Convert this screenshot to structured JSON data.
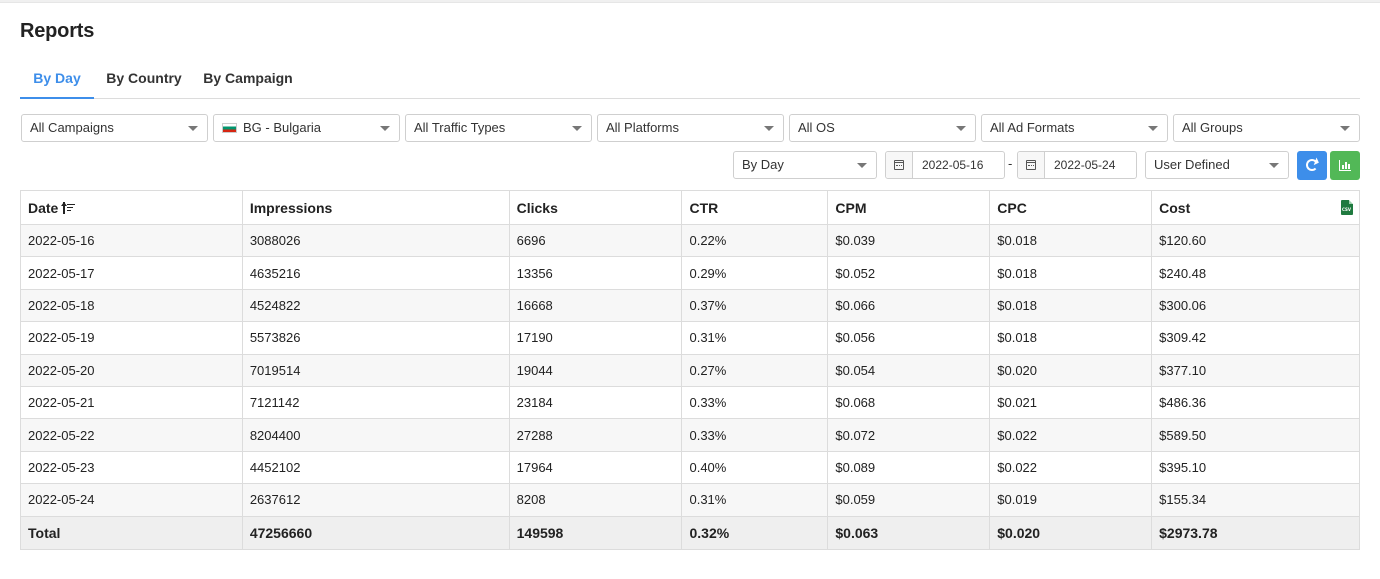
{
  "page": {
    "title": "Reports"
  },
  "tabs": [
    {
      "label": "By Day",
      "active": true
    },
    {
      "label": "By Country",
      "active": false
    },
    {
      "label": "By Campaign",
      "active": false
    }
  ],
  "filters": {
    "campaigns": "All Campaigns",
    "country": "BG - Bulgaria",
    "traffic_types": "All Traffic Types",
    "platforms": "All Platforms",
    "os": "All OS",
    "ad_formats": "All Ad Formats",
    "groups": "All Groups",
    "group_by": "By Day",
    "date_from": "2022-05-16",
    "date_separator": "-",
    "date_to": "2022-05-24",
    "range_preset": "User Defined"
  },
  "icons": {
    "country_flag": "bulgaria-flag-icon",
    "calendar": "calendar-icon",
    "refresh": "refresh-icon",
    "chart": "bar-chart-icon",
    "sort": "sort-ascending-icon",
    "export": "csv-export-icon"
  },
  "colors": {
    "accent": "#3d8eea",
    "success": "#52b857",
    "csv": "#1f7a3f"
  },
  "table": {
    "columns": [
      "Date",
      "Impressions",
      "Clicks",
      "CTR",
      "CPM",
      "CPC",
      "Cost"
    ],
    "csv_label": "CSV",
    "rows": [
      [
        "2022-05-16",
        "3088026",
        "6696",
        "0.22%",
        "$0.039",
        "$0.018",
        "$120.60"
      ],
      [
        "2022-05-17",
        "4635216",
        "13356",
        "0.29%",
        "$0.052",
        "$0.018",
        "$240.48"
      ],
      [
        "2022-05-18",
        "4524822",
        "16668",
        "0.37%",
        "$0.066",
        "$0.018",
        "$300.06"
      ],
      [
        "2022-05-19",
        "5573826",
        "17190",
        "0.31%",
        "$0.056",
        "$0.018",
        "$309.42"
      ],
      [
        "2022-05-20",
        "7019514",
        "19044",
        "0.27%",
        "$0.054",
        "$0.020",
        "$377.10"
      ],
      [
        "2022-05-21",
        "7121142",
        "23184",
        "0.33%",
        "$0.068",
        "$0.021",
        "$486.36"
      ],
      [
        "2022-05-22",
        "8204400",
        "27288",
        "0.33%",
        "$0.072",
        "$0.022",
        "$589.50"
      ],
      [
        "2022-05-23",
        "4452102",
        "17964",
        "0.40%",
        "$0.089",
        "$0.022",
        "$395.10"
      ],
      [
        "2022-05-24",
        "2637612",
        "8208",
        "0.31%",
        "$0.059",
        "$0.019",
        "$155.34"
      ]
    ],
    "total": [
      "Total",
      "47256660",
      "149598",
      "0.32%",
      "$0.063",
      "$0.020",
      "$2973.78"
    ]
  }
}
